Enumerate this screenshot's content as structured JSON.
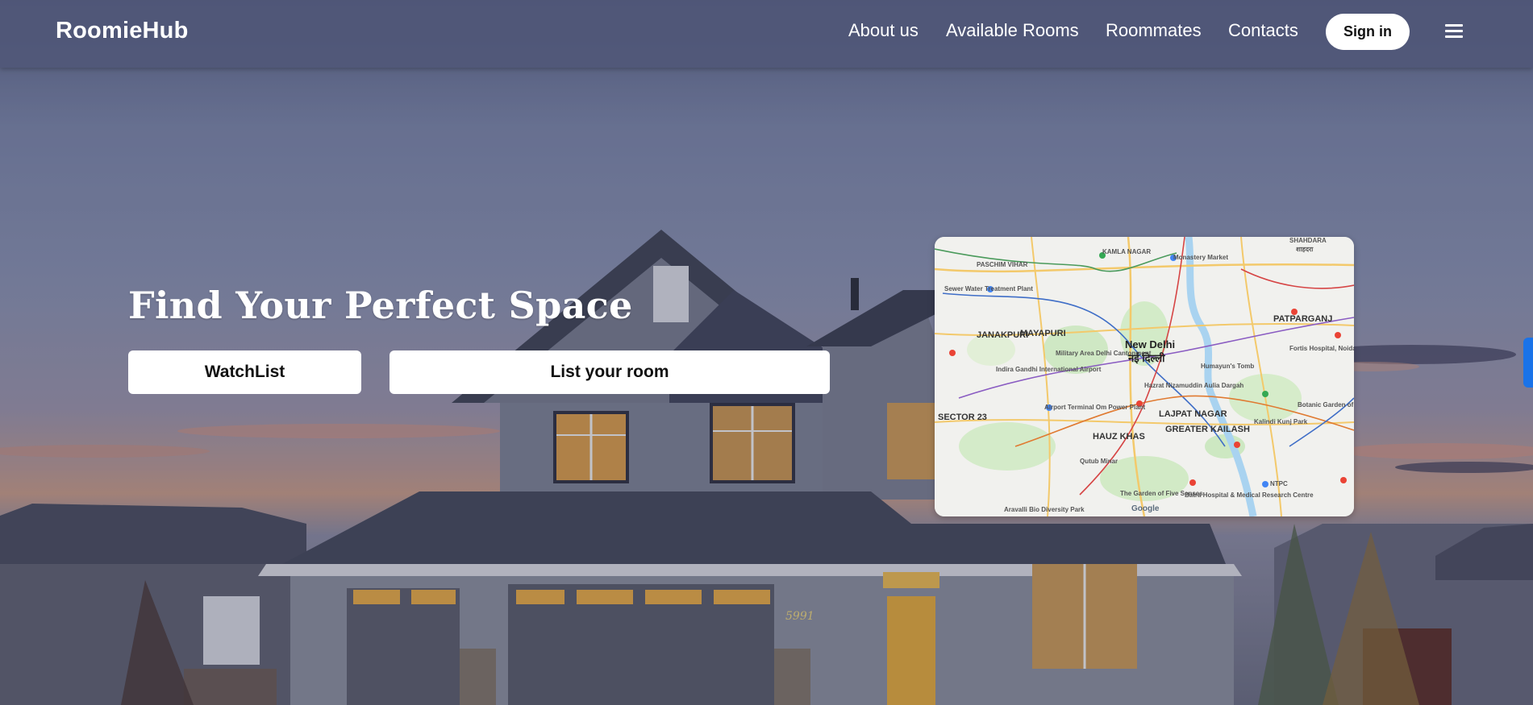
{
  "navbar": {
    "brand": "RoomieHub",
    "links": [
      {
        "label": "About us"
      },
      {
        "label": "Available Rooms"
      },
      {
        "label": "Roommates"
      },
      {
        "label": "Contacts"
      }
    ],
    "signin_label": "Sign in",
    "menu_icon": "hamburger-menu-icon"
  },
  "hero": {
    "title": "Find Your Perfect Space",
    "watchlist_label": "WatchList",
    "list_room_label": "List your room",
    "house_number": "5991"
  },
  "map": {
    "labels": {
      "shahdara": "SHAHDARA",
      "shahdara_hi": "शाहदरा",
      "kamla_nagar": "KAMLA NAGAR",
      "monastery": "Monastery Market",
      "paschim_vihar": "PASCHIM VIHAR",
      "sewer": "Sewer Water Treatment Plant",
      "patparganj": "PATPARGANJ",
      "janakpuri": "JANAKPURI",
      "mayapuri": "MAYAPURI",
      "new_delhi": "New Delhi",
      "new_delhi_hi": "नई दिल्ली",
      "military": "Military Area Delhi Cantonment",
      "igi": "Indira Gandhi International Airport",
      "nizamuddin": "Hazrat Nizamuddin Aulia Dargah",
      "humayun": "Humayun's Tomb",
      "fortis": "Fortis Hospital, Noida",
      "sector23": "SECTOR 23",
      "lajpat": "LAJPAT NAGAR",
      "botanic": "Botanic Garden of Indian Republic",
      "airport_terminal": "Airport Terminal Om Power Plant",
      "hauz_khas": "HAUZ KHAS",
      "greater_kailash": "GREATER KAILASH",
      "kalindi": "Kalindi Kunj Park",
      "qutub": "Qutub Minar",
      "garden": "The Garden of Five Senses",
      "batra": "Batra Hospital & Medical Research Centre",
      "ntpc": "NTPC",
      "aravalli": "Aravalli Bio Diversity Park",
      "attribution": "Google"
    }
  }
}
